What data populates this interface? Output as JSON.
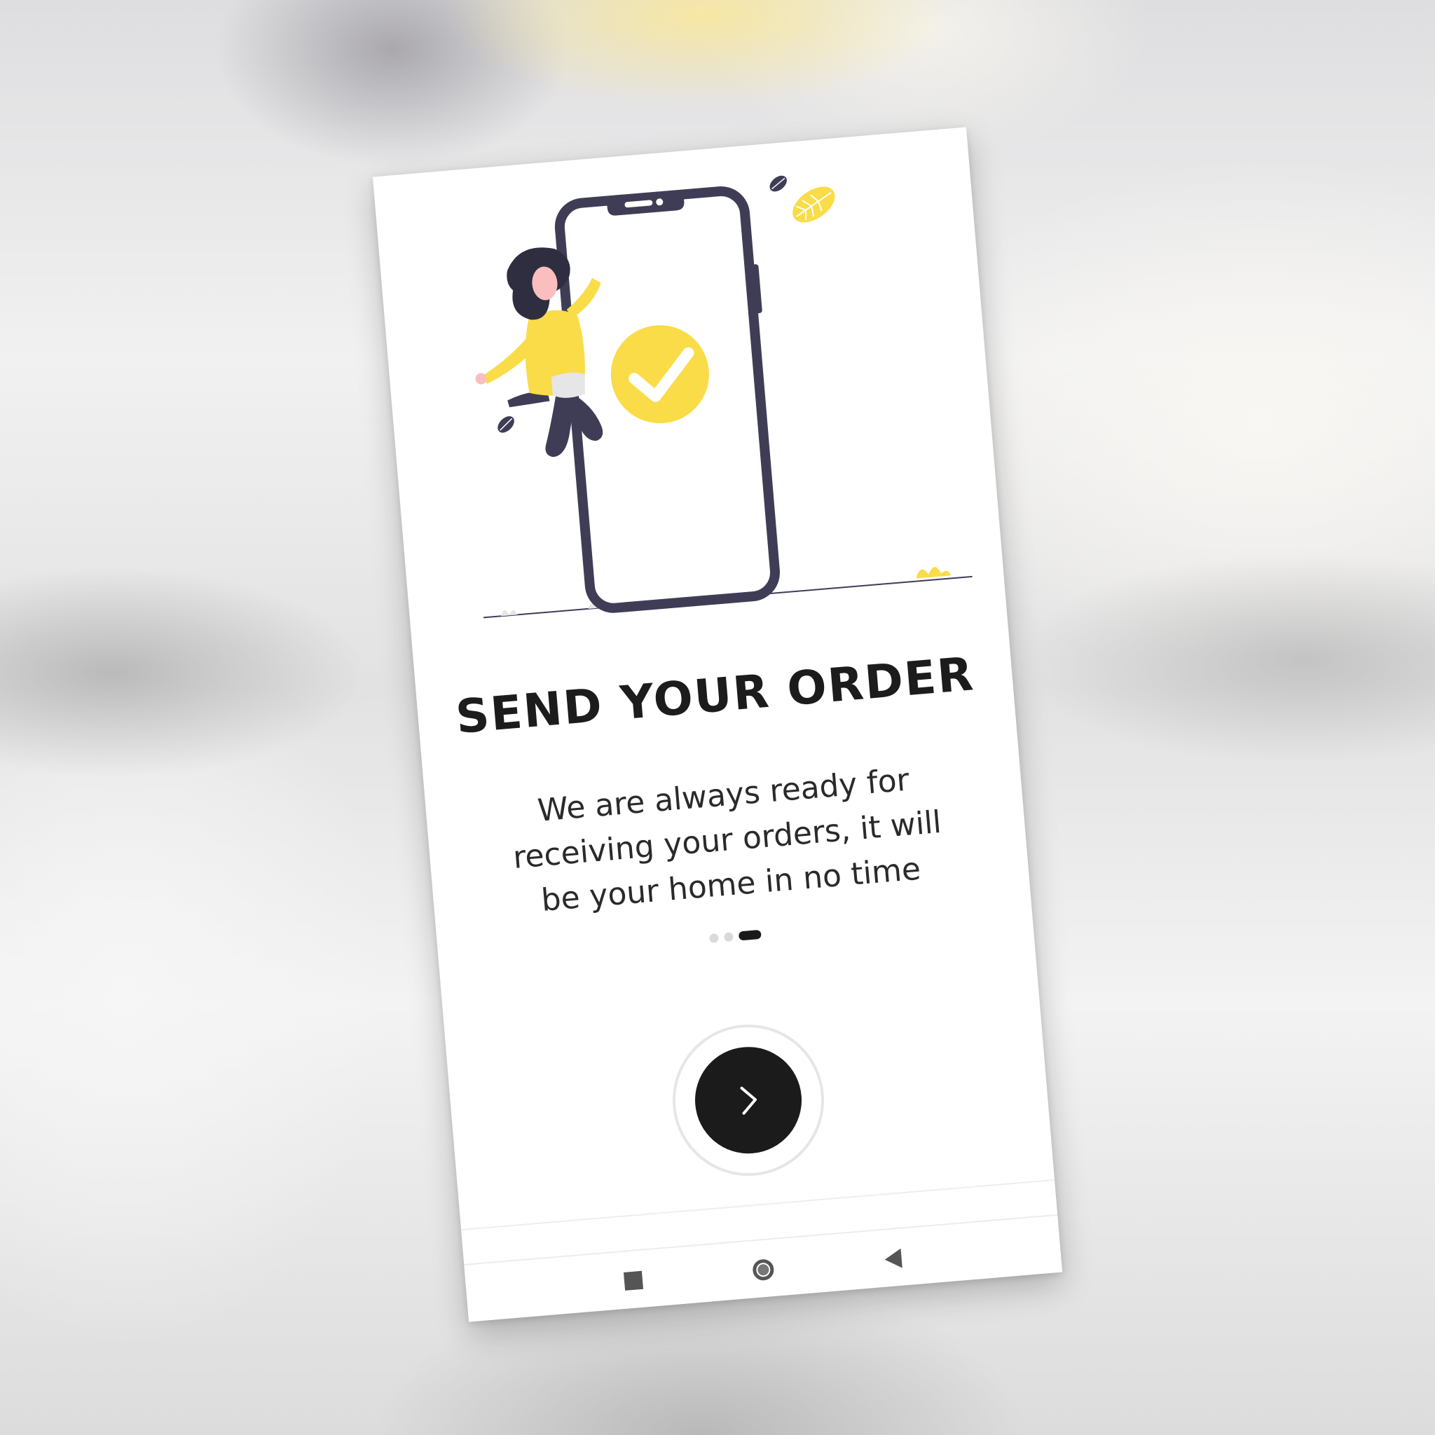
{
  "onboarding": {
    "title": "SEND YOUR ORDER",
    "subtitle": "We are always ready for receiving your orders, it will be your home in no time",
    "illustration_icon": "woman-jumping-with-phone-checkmark",
    "pagination": {
      "total": 3,
      "active": 3
    },
    "next_button_icon": "chevron-right-icon"
  },
  "system_nav": {
    "recents_icon": "square-icon",
    "home_icon": "circle-icon",
    "back_icon": "triangle-back-icon"
  },
  "colors": {
    "accent_yellow": "#f9dc48",
    "dark": "#1b1b1b",
    "illustration_dark": "#3f3d56"
  }
}
